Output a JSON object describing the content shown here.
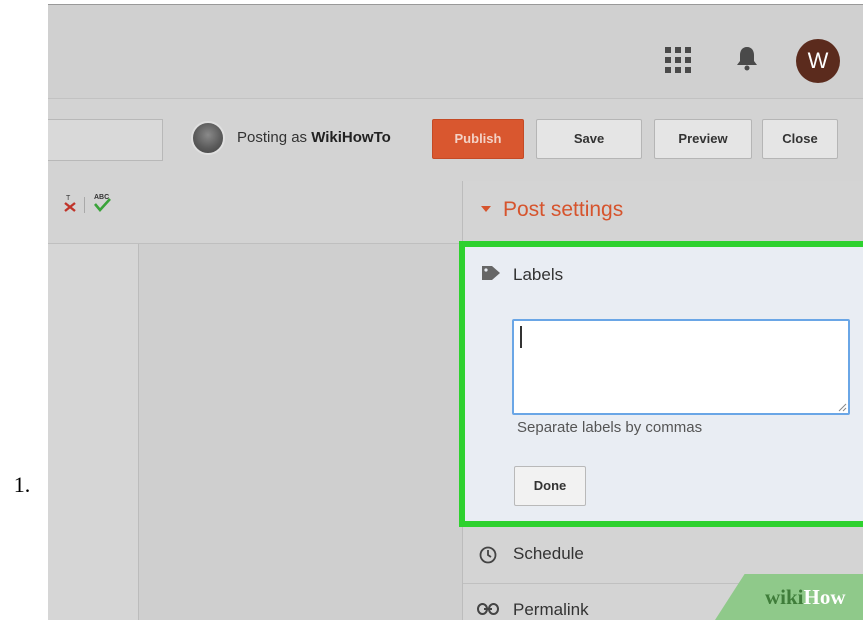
{
  "step": {
    "number": "1."
  },
  "header": {
    "avatar_letter": "W",
    "avatar_color": "#5b2b1d"
  },
  "toolbar": {
    "posting_prefix": "Posting as ",
    "posting_user": "WikiHowTo",
    "publish_label": "Publish",
    "save_label": "Save",
    "preview_label": "Preview",
    "close_label": "Close",
    "publish_color": "#d9572f"
  },
  "post_settings": {
    "title": "Post settings",
    "labels": {
      "heading": "Labels",
      "input_value": "",
      "hint": "Separate labels by commas",
      "done_label": "Done",
      "highlight_color": "#2ed12e"
    },
    "schedule_label": "Schedule",
    "permalink_label": "Permalink"
  },
  "watermark": {
    "wiki": "wiki",
    "how": "How"
  },
  "icons": [
    "apps-icon",
    "bell-icon",
    "remove-format-icon",
    "spellcheck-icon",
    "caret-icon",
    "tag-icon",
    "clock-icon",
    "link-icon"
  ]
}
